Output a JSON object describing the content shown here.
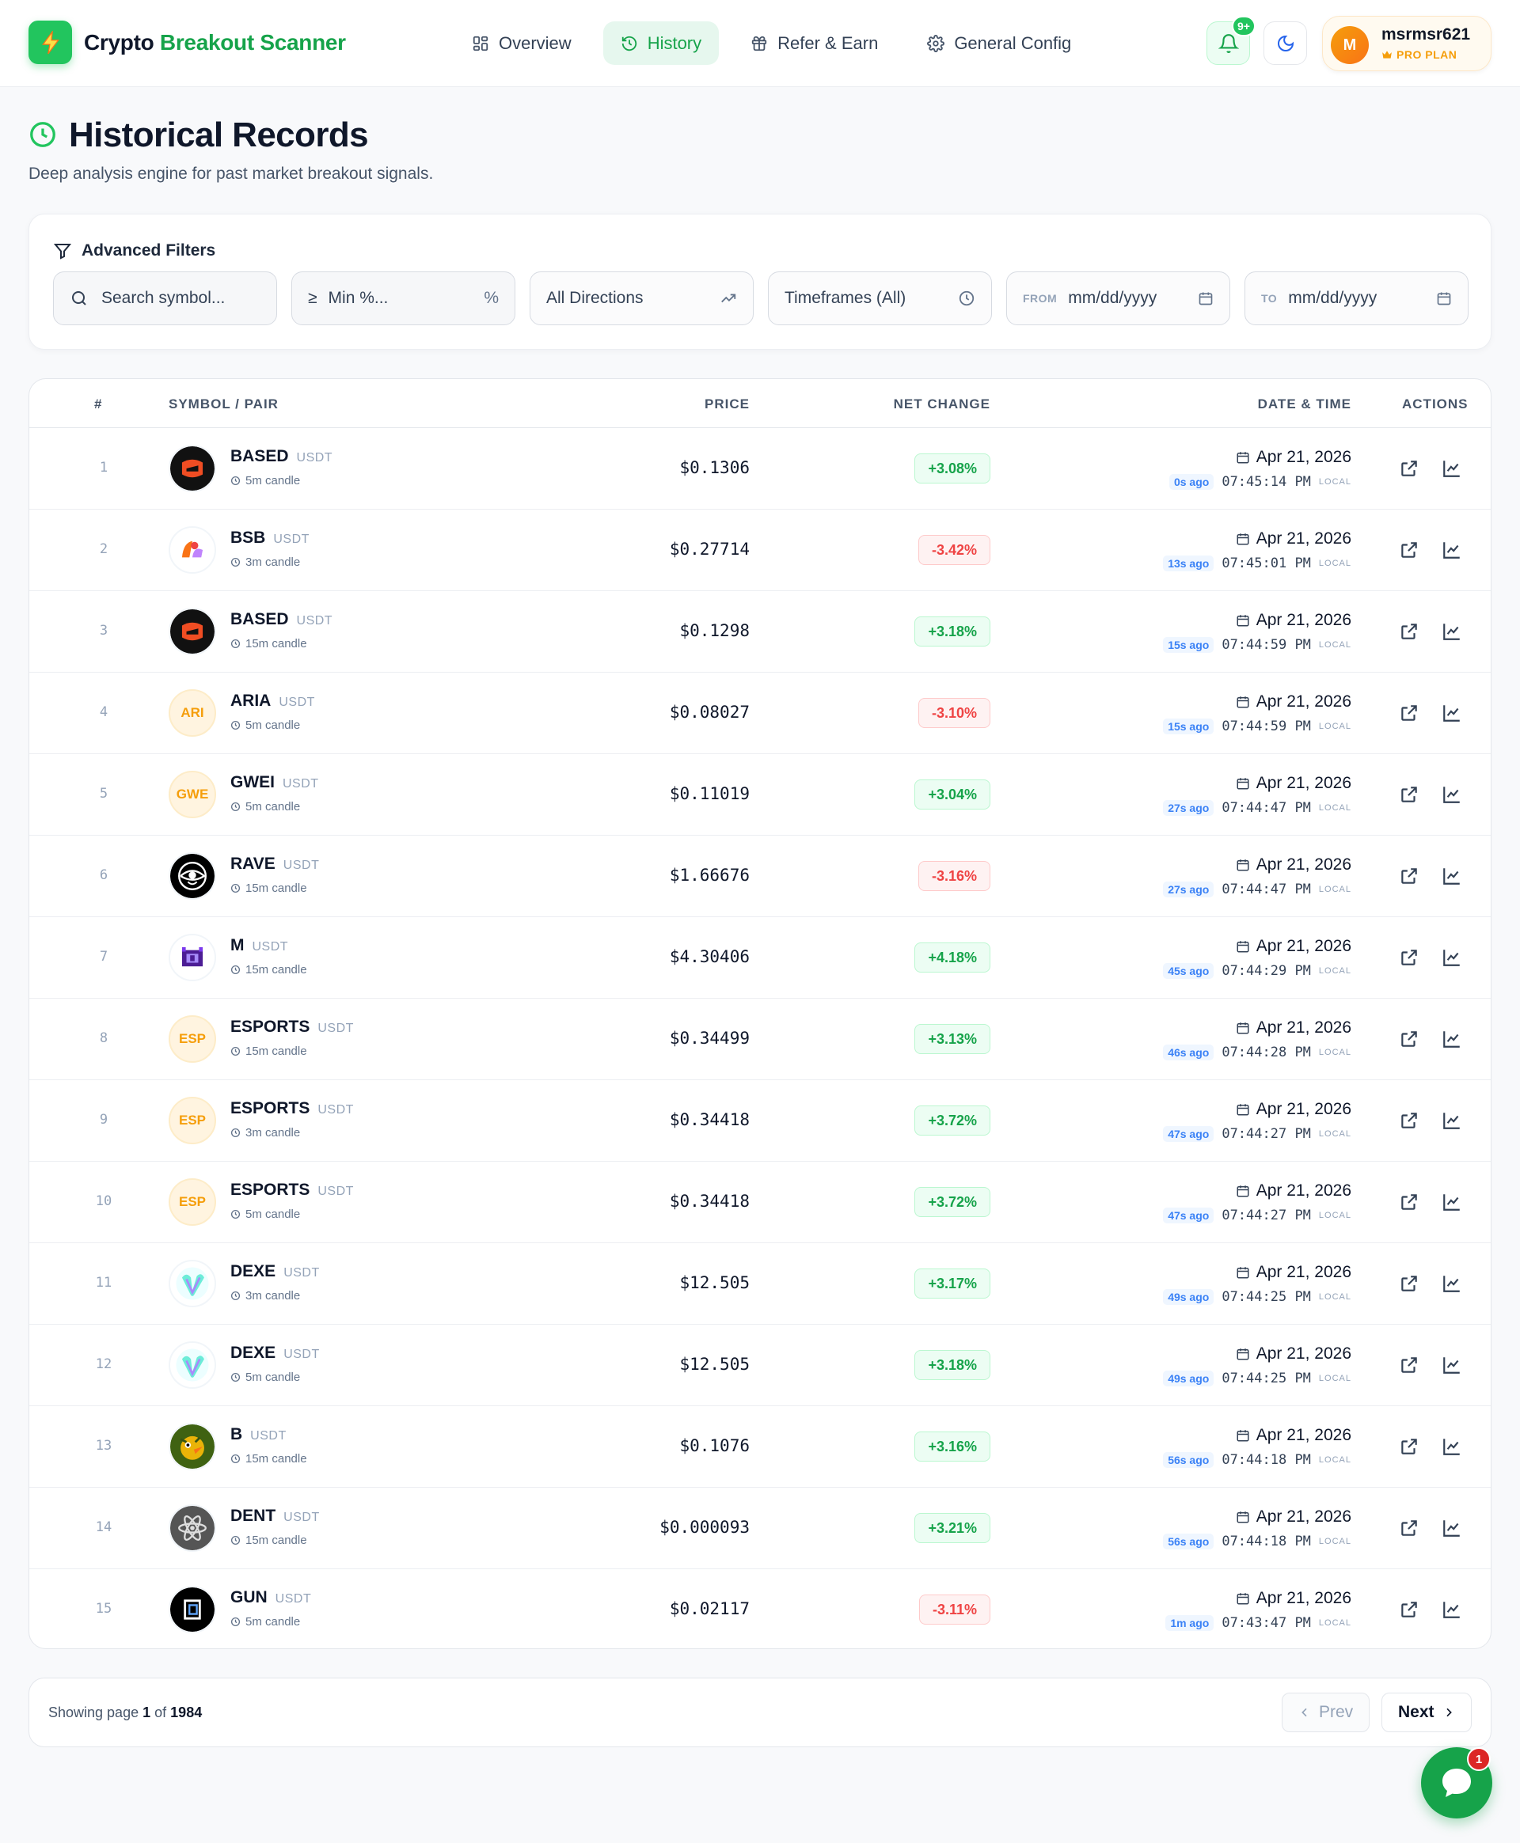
{
  "header": {
    "brand_main": "Crypto",
    "brand_accent": "Breakout Scanner",
    "nav": [
      {
        "label": "Overview",
        "icon": "grid-icon"
      },
      {
        "label": "History",
        "icon": "history-icon",
        "active": true
      },
      {
        "label": "Refer & Earn",
        "icon": "gift-icon"
      },
      {
        "label": "General Config",
        "icon": "gear-icon"
      }
    ],
    "notifications": "9+",
    "user": {
      "initial": "M",
      "name": "msrmsr621",
      "plan": "PRO PLAN"
    }
  },
  "page": {
    "title": "Historical Records",
    "subtitle": "Deep analysis engine for past market breakout signals."
  },
  "filters": {
    "title": "Advanced Filters",
    "search_placeholder": "Search symbol...",
    "min_placeholder": "Min %...",
    "min_symbol": "≥",
    "min_unit": "%",
    "direction": "All Directions",
    "timeframe": "Timeframes (All)",
    "from_label": "FROM",
    "from_value": "mm/dd/yyyy",
    "to_label": "TO",
    "to_value": "mm/dd/yyyy"
  },
  "table": {
    "columns": {
      "index": "#",
      "symbol": "SYMBOL / PAIR",
      "price": "PRICE",
      "change": "NET CHANGE",
      "datetime": "DATE & TIME",
      "actions": "ACTIONS"
    },
    "local_label": "LOCAL",
    "rows": [
      {
        "idx": "1",
        "symbol": "BASED",
        "quote": "USDT",
        "tf": "5m candle",
        "price": "$0.1306",
        "change": "+3.08%",
        "dir": "up",
        "date": "Apr 21, 2026",
        "ago": "0s ago",
        "time": "07:45:14 PM",
        "logo": "based"
      },
      {
        "idx": "2",
        "symbol": "BSB",
        "quote": "USDT",
        "tf": "3m candle",
        "price": "$0.27714",
        "change": "-3.42%",
        "dir": "down",
        "date": "Apr 21, 2026",
        "ago": "13s ago",
        "time": "07:45:01 PM",
        "logo": "bsb"
      },
      {
        "idx": "3",
        "symbol": "BASED",
        "quote": "USDT",
        "tf": "15m candle",
        "price": "$0.1298",
        "change": "+3.18%",
        "dir": "up",
        "date": "Apr 21, 2026",
        "ago": "15s ago",
        "time": "07:44:59 PM",
        "logo": "based"
      },
      {
        "idx": "4",
        "symbol": "ARIA",
        "quote": "USDT",
        "tf": "5m candle",
        "price": "$0.08027",
        "change": "-3.10%",
        "dir": "down",
        "date": "Apr 21, 2026",
        "ago": "15s ago",
        "time": "07:44:59 PM",
        "logo": "text",
        "logo_text": "ARI"
      },
      {
        "idx": "5",
        "symbol": "GWEI",
        "quote": "USDT",
        "tf": "5m candle",
        "price": "$0.11019",
        "change": "+3.04%",
        "dir": "up",
        "date": "Apr 21, 2026",
        "ago": "27s ago",
        "time": "07:44:47 PM",
        "logo": "text",
        "logo_text": "GWE"
      },
      {
        "idx": "6",
        "symbol": "RAVE",
        "quote": "USDT",
        "tf": "15m candle",
        "price": "$1.66676",
        "change": "-3.16%",
        "dir": "down",
        "date": "Apr 21, 2026",
        "ago": "27s ago",
        "time": "07:44:47 PM",
        "logo": "rave"
      },
      {
        "idx": "7",
        "symbol": "M",
        "quote": "USDT",
        "tf": "15m candle",
        "price": "$4.30406",
        "change": "+4.18%",
        "dir": "up",
        "date": "Apr 21, 2026",
        "ago": "45s ago",
        "time": "07:44:29 PM",
        "logo": "m"
      },
      {
        "idx": "8",
        "symbol": "ESPORTS",
        "quote": "USDT",
        "tf": "15m candle",
        "price": "$0.34499",
        "change": "+3.13%",
        "dir": "up",
        "date": "Apr 21, 2026",
        "ago": "46s ago",
        "time": "07:44:28 PM",
        "logo": "text",
        "logo_text": "ESP"
      },
      {
        "idx": "9",
        "symbol": "ESPORTS",
        "quote": "USDT",
        "tf": "3m candle",
        "price": "$0.34418",
        "change": "+3.72%",
        "dir": "up",
        "date": "Apr 21, 2026",
        "ago": "47s ago",
        "time": "07:44:27 PM",
        "logo": "text",
        "logo_text": "ESP"
      },
      {
        "idx": "10",
        "symbol": "ESPORTS",
        "quote": "USDT",
        "tf": "5m candle",
        "price": "$0.34418",
        "change": "+3.72%",
        "dir": "up",
        "date": "Apr 21, 2026",
        "ago": "47s ago",
        "time": "07:44:27 PM",
        "logo": "text",
        "logo_text": "ESP"
      },
      {
        "idx": "11",
        "symbol": "DEXE",
        "quote": "USDT",
        "tf": "3m candle",
        "price": "$12.505",
        "change": "+3.17%",
        "dir": "up",
        "date": "Apr 21, 2026",
        "ago": "49s ago",
        "time": "07:44:25 PM",
        "logo": "dexe"
      },
      {
        "idx": "12",
        "symbol": "DEXE",
        "quote": "USDT",
        "tf": "5m candle",
        "price": "$12.505",
        "change": "+3.18%",
        "dir": "up",
        "date": "Apr 21, 2026",
        "ago": "49s ago",
        "time": "07:44:25 PM",
        "logo": "dexe"
      },
      {
        "idx": "13",
        "symbol": "B",
        "quote": "USDT",
        "tf": "15m candle",
        "price": "$0.1076",
        "change": "+3.16%",
        "dir": "up",
        "date": "Apr 21, 2026",
        "ago": "56s ago",
        "time": "07:44:18 PM",
        "logo": "b"
      },
      {
        "idx": "14",
        "symbol": "DENT",
        "quote": "USDT",
        "tf": "15m candle",
        "price": "$0.000093",
        "change": "+3.21%",
        "dir": "up",
        "date": "Apr 21, 2026",
        "ago": "56s ago",
        "time": "07:44:18 PM",
        "logo": "dent"
      },
      {
        "idx": "15",
        "symbol": "GUN",
        "quote": "USDT",
        "tf": "5m candle",
        "price": "$0.02117",
        "change": "-3.11%",
        "dir": "down",
        "date": "Apr 21, 2026",
        "ago": "1m ago",
        "time": "07:43:47 PM",
        "logo": "gun"
      }
    ]
  },
  "pagination": {
    "prefix": "Showing page",
    "current": "1",
    "of": "of",
    "total": "1984",
    "prev": "Prev",
    "next": "Next"
  },
  "chat": {
    "badge": "1"
  },
  "colors": {
    "accent": "#16a34a",
    "up": "#16a34a",
    "down": "#ef4444",
    "ago": "#3b82f6",
    "plan": "#f59e0b"
  }
}
